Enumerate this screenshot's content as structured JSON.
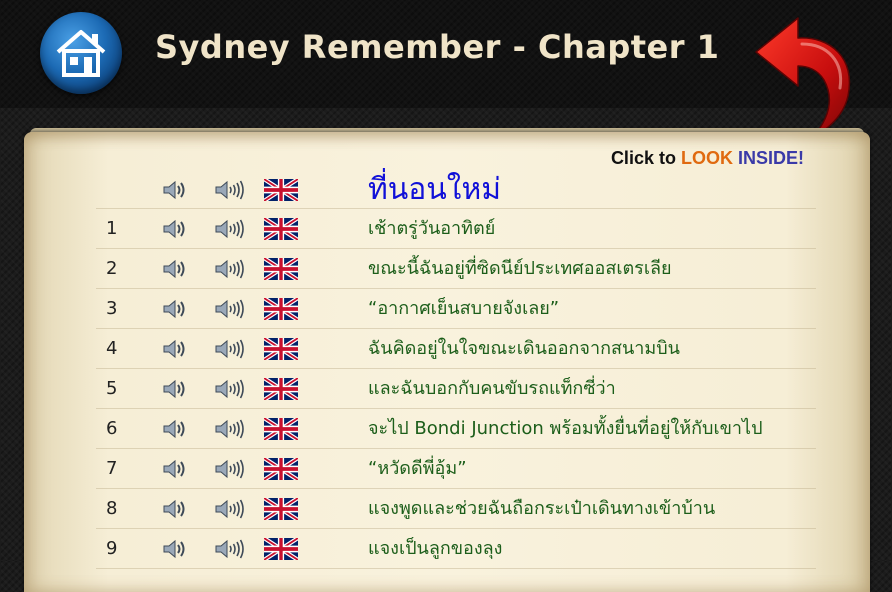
{
  "page": {
    "title": "Sydney Remember - Chapter 1"
  },
  "promo": {
    "prefix": "Click to",
    "look": "LOOK",
    "inside": "INSIDE!"
  },
  "section_heading": "ที่นอนใหม่",
  "rows": [
    {
      "num": "1",
      "text": "เช้าตรู่วันอาทิตย์"
    },
    {
      "num": "2",
      "text": "ขณะนี้ฉันอยู่ที่ซิดนีย์ประเทศออสเตรเลีย"
    },
    {
      "num": "3",
      "text": "“อากาศเย็นสบายจังเลย”"
    },
    {
      "num": "4",
      "text": "ฉันคิดอยู่ในใจขณะเดินออกจากสนามบิน"
    },
    {
      "num": "5",
      "text": "และฉันบอกกับคนขับรถแท็กซี่ว่า"
    },
    {
      "num": "6",
      "text": "จะไป Bondi Junction พร้อมทั้งยื่นที่อยู่ให้กับเขาไป"
    },
    {
      "num": "7",
      "text": "“หวัดดีพี่อุ้ม”"
    },
    {
      "num": "8",
      "text": "แจงพูดและช่วยฉันถือกระเป๋าเดินทางเข้าบ้าน"
    },
    {
      "num": "9",
      "text": "แจงเป็นลูกของลุง"
    }
  ],
  "icons": {
    "home": "home-icon",
    "back": "back-arrow-icon",
    "speaker_normal": "speaker-normal-icon",
    "speaker_slow": "speaker-slow-icon",
    "flag": "uk-flag-icon"
  },
  "colors": {
    "thai_text": "#1c5e1a",
    "heading_text": "#1010d8",
    "look": "#e06a10",
    "inside": "#3a3aa8",
    "title": "#f0e4c8"
  }
}
